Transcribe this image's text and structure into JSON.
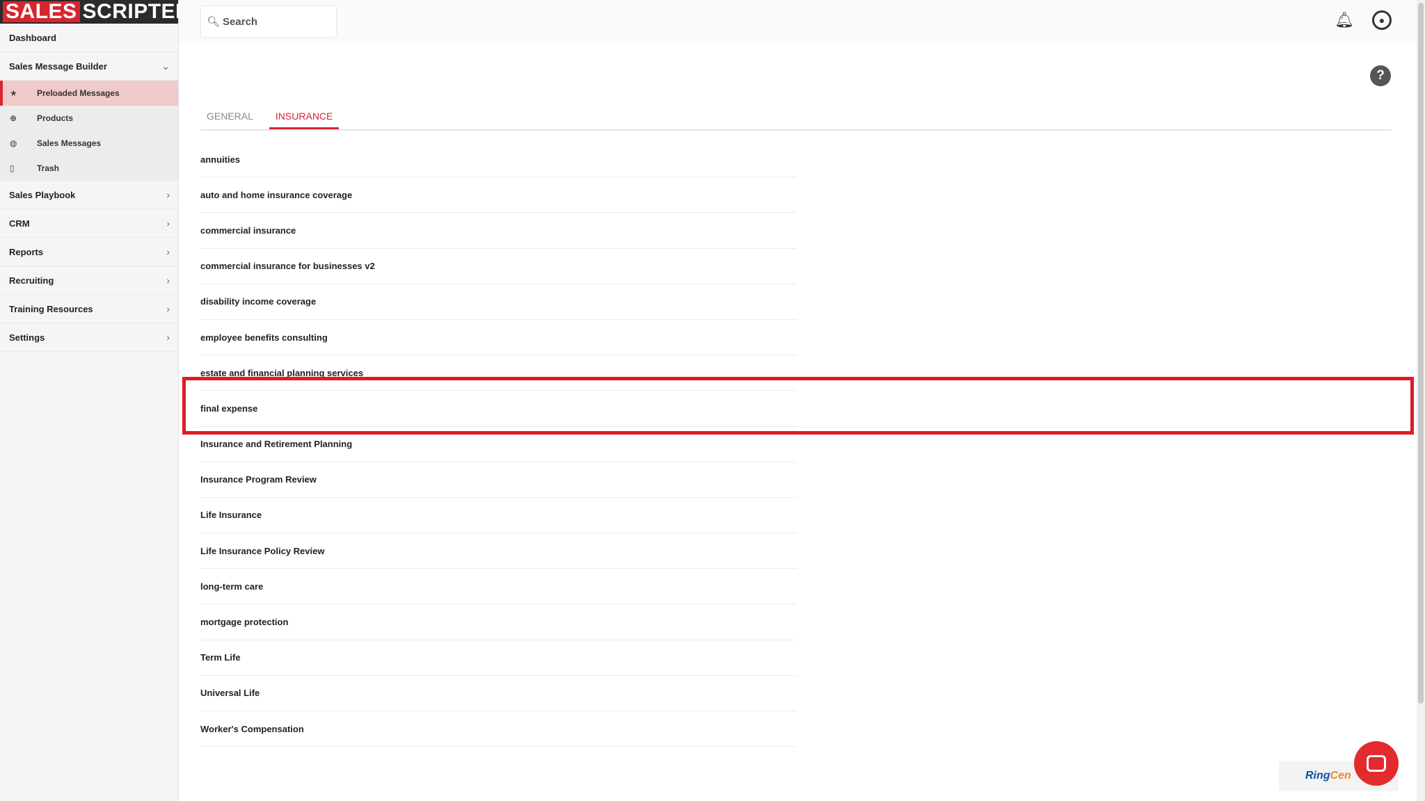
{
  "logo": {
    "left": "SALES",
    "right": "SCRIPTER"
  },
  "sidebar": {
    "dashboard": "Dashboard",
    "group": {
      "label": "Sales Message Builder",
      "chevron": "⌄"
    },
    "subitems": [
      {
        "label": "Preloaded Messages",
        "icon": "★",
        "active": true
      },
      {
        "label": "Products",
        "icon": "⊕",
        "active": false
      },
      {
        "label": "Sales Messages",
        "icon": "◍",
        "active": false
      },
      {
        "label": "Trash",
        "icon": "▯",
        "active": false
      }
    ],
    "items": [
      {
        "label": "Sales Playbook"
      },
      {
        "label": "CRM"
      },
      {
        "label": "Reports"
      },
      {
        "label": "Recruiting"
      },
      {
        "label": "Training Resources"
      },
      {
        "label": "Settings"
      }
    ],
    "chevron": "›"
  },
  "search": {
    "placeholder": "Search",
    "icon": "search-icon"
  },
  "header": {
    "bell_icon": "bell-icon",
    "user_icon": "account-circle-icon",
    "help": "?"
  },
  "tabs": [
    {
      "label": "GENERAL",
      "active": false
    },
    {
      "label": "INSURANCE",
      "active": true
    }
  ],
  "list": [
    "annuities",
    "auto and home insurance coverage",
    "commercial insurance",
    "commercial insurance for businesses v2",
    "disability income coverage",
    "employee benefits consulting",
    "estate and financial planning services",
    "final expense",
    "Insurance and Retirement Planning",
    "Insurance Program Review",
    "Life Insurance",
    "Life Insurance Policy Review",
    "long-term care",
    "mortgage protection",
    "Term Life",
    "Universal Life",
    "Worker's Compensation"
  ],
  "highlighted_item": "final expense",
  "ringcentral": {
    "part1": "Ring",
    "part2": "Cen"
  },
  "colors": {
    "accent": "#d7262e",
    "highlight_border": "#e01b23"
  }
}
